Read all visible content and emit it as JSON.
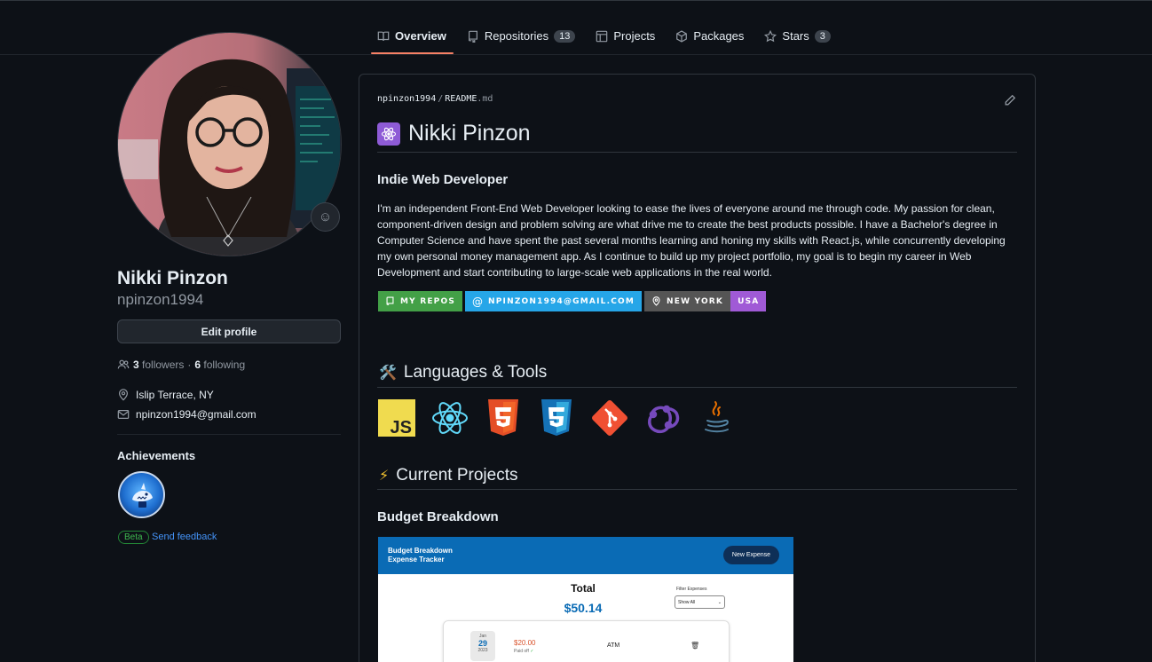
{
  "nav": {
    "tabs": [
      {
        "label": "Overview",
        "icon": "book-icon",
        "active": true
      },
      {
        "label": "Repositories",
        "icon": "repo-icon",
        "count": "13"
      },
      {
        "label": "Projects",
        "icon": "table-icon"
      },
      {
        "label": "Packages",
        "icon": "package-icon"
      },
      {
        "label": "Stars",
        "icon": "star-icon",
        "count": "3"
      }
    ]
  },
  "profile": {
    "full_name": "Nikki Pinzon",
    "username": "npinzon1994",
    "edit_label": "Edit profile",
    "followers_count": "3",
    "followers_label": "followers",
    "following_count": "6",
    "following_label": "following",
    "location": "Islip Terrace, NY",
    "email": "npinzon1994@gmail.com",
    "achievements_title": "Achievements",
    "beta_label": "Beta",
    "feedback_label": "Send feedback"
  },
  "readme": {
    "path_user": "npinzon1994",
    "path_file": "README",
    "path_ext": ".md",
    "title": "Nikki Pinzon",
    "subtitle": "Indie Web Developer",
    "bio": "I'm an independent Front-End Web Developer looking to ease the lives of everyone around me through code. My passion for clean, component-driven design and problem solving are what drive me to create the best products possible. I have a Bachelor's degree in Computer Science and have spent the past several months learning and honing my skills with React.js, while concurrently developing my own personal money management app. As I continue to build up my project portfolio, my goal is to begin my career in Web Development and start contributing to large-scale web applications in the real world.",
    "shields": {
      "repos": "MY REPOS",
      "email": "NPINZON1994@GMAIL.COM",
      "location": "NEW YORK",
      "country": "USA"
    },
    "languages_heading": "Languages & Tools",
    "languages_emoji": "🛠️",
    "tools": [
      "javascript-icon",
      "react-icon",
      "html5-icon",
      "css3-icon",
      "git-icon",
      "redux-icon",
      "java-icon"
    ],
    "projects_heading": "Current Projects",
    "projects_emoji": "⚡",
    "project_title": "Budget Breakdown"
  },
  "project_shot": {
    "app_title": "Budget Breakdown Expense Tracker",
    "new_button": "New Expense",
    "total_label": "Total",
    "total_amount": "$50.14",
    "filter_label": "Filter Expenses",
    "filter_value": "Show All",
    "item": {
      "month": "Jan",
      "day": "29",
      "year": "2023",
      "price": "$20.00",
      "paid": "Paid off",
      "description": "ATM"
    }
  },
  "colors": {
    "background": "#0d1117",
    "accent_tab": "#f78166",
    "link": "#4493f8",
    "beta_green": "#3fb950"
  }
}
